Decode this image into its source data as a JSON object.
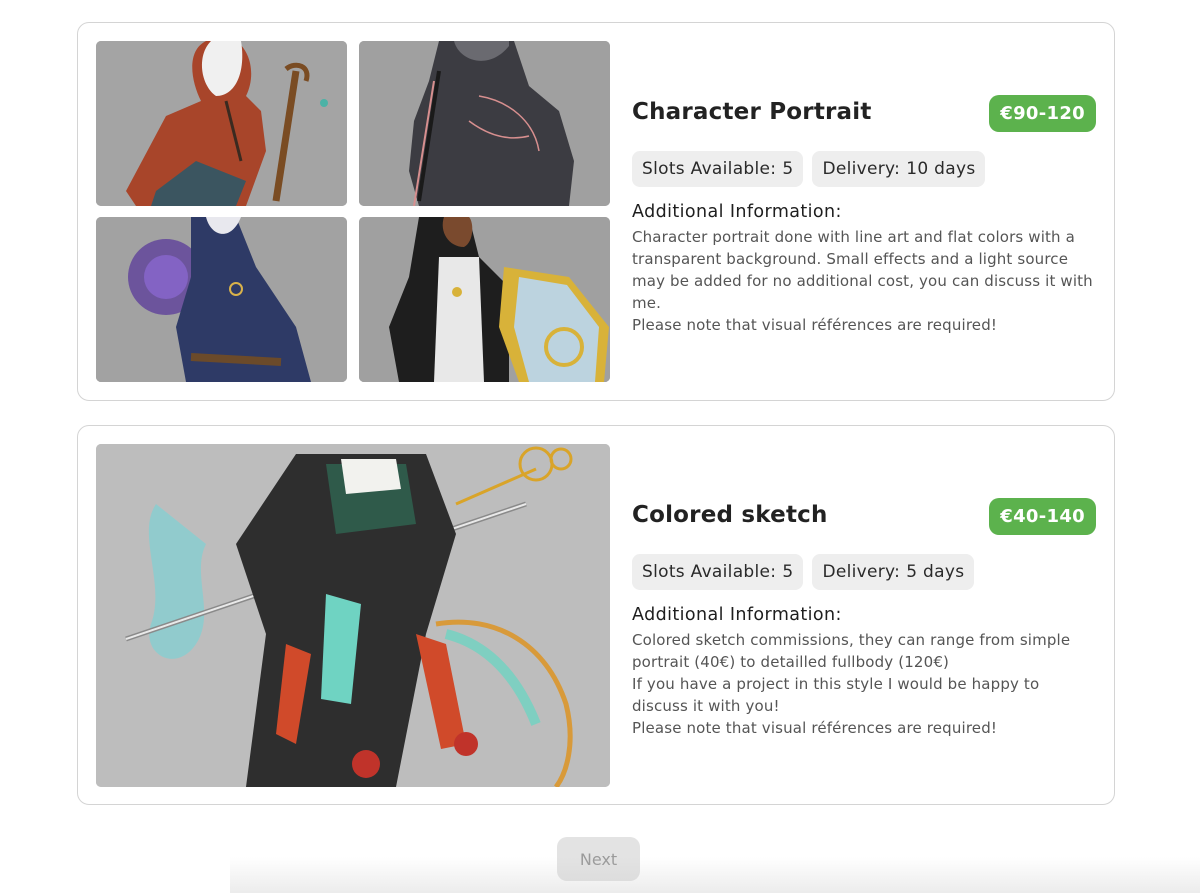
{
  "commissions": [
    {
      "title": "Character Portrait",
      "price": "€90-120",
      "slots_label": "Slots Available:",
      "slots_value": "5",
      "delivery_label": "Delivery:",
      "delivery_value": "10 days",
      "additional_heading": "Additional Information:",
      "description": "Character portrait done with line art and flat colors with a transparent background. Small effects and a light source may be added for no additional cost, you can discuss it with me.\nPlease note that visual références are required!"
    },
    {
      "title": "Colored sketch",
      "price": "€40-140",
      "slots_label": "Slots Available:",
      "slots_value": "5",
      "delivery_label": "Delivery:",
      "delivery_value": "5 days",
      "additional_heading": "Additional Information:",
      "description": "Colored sketch commissions, they can range from simple portrait (40€) to detailled fullbody (120€)\nIf you have a project in this style I would be happy to discuss it with you!\nPlease note that visual références are required!"
    }
  ],
  "pagination": {
    "next_label": "Next"
  },
  "colors": {
    "price_badge": "#5cb24d",
    "chip_bg": "#eeeeee",
    "card_border": "#d4d4d4",
    "thumb_bg": "#a3a3a3"
  }
}
